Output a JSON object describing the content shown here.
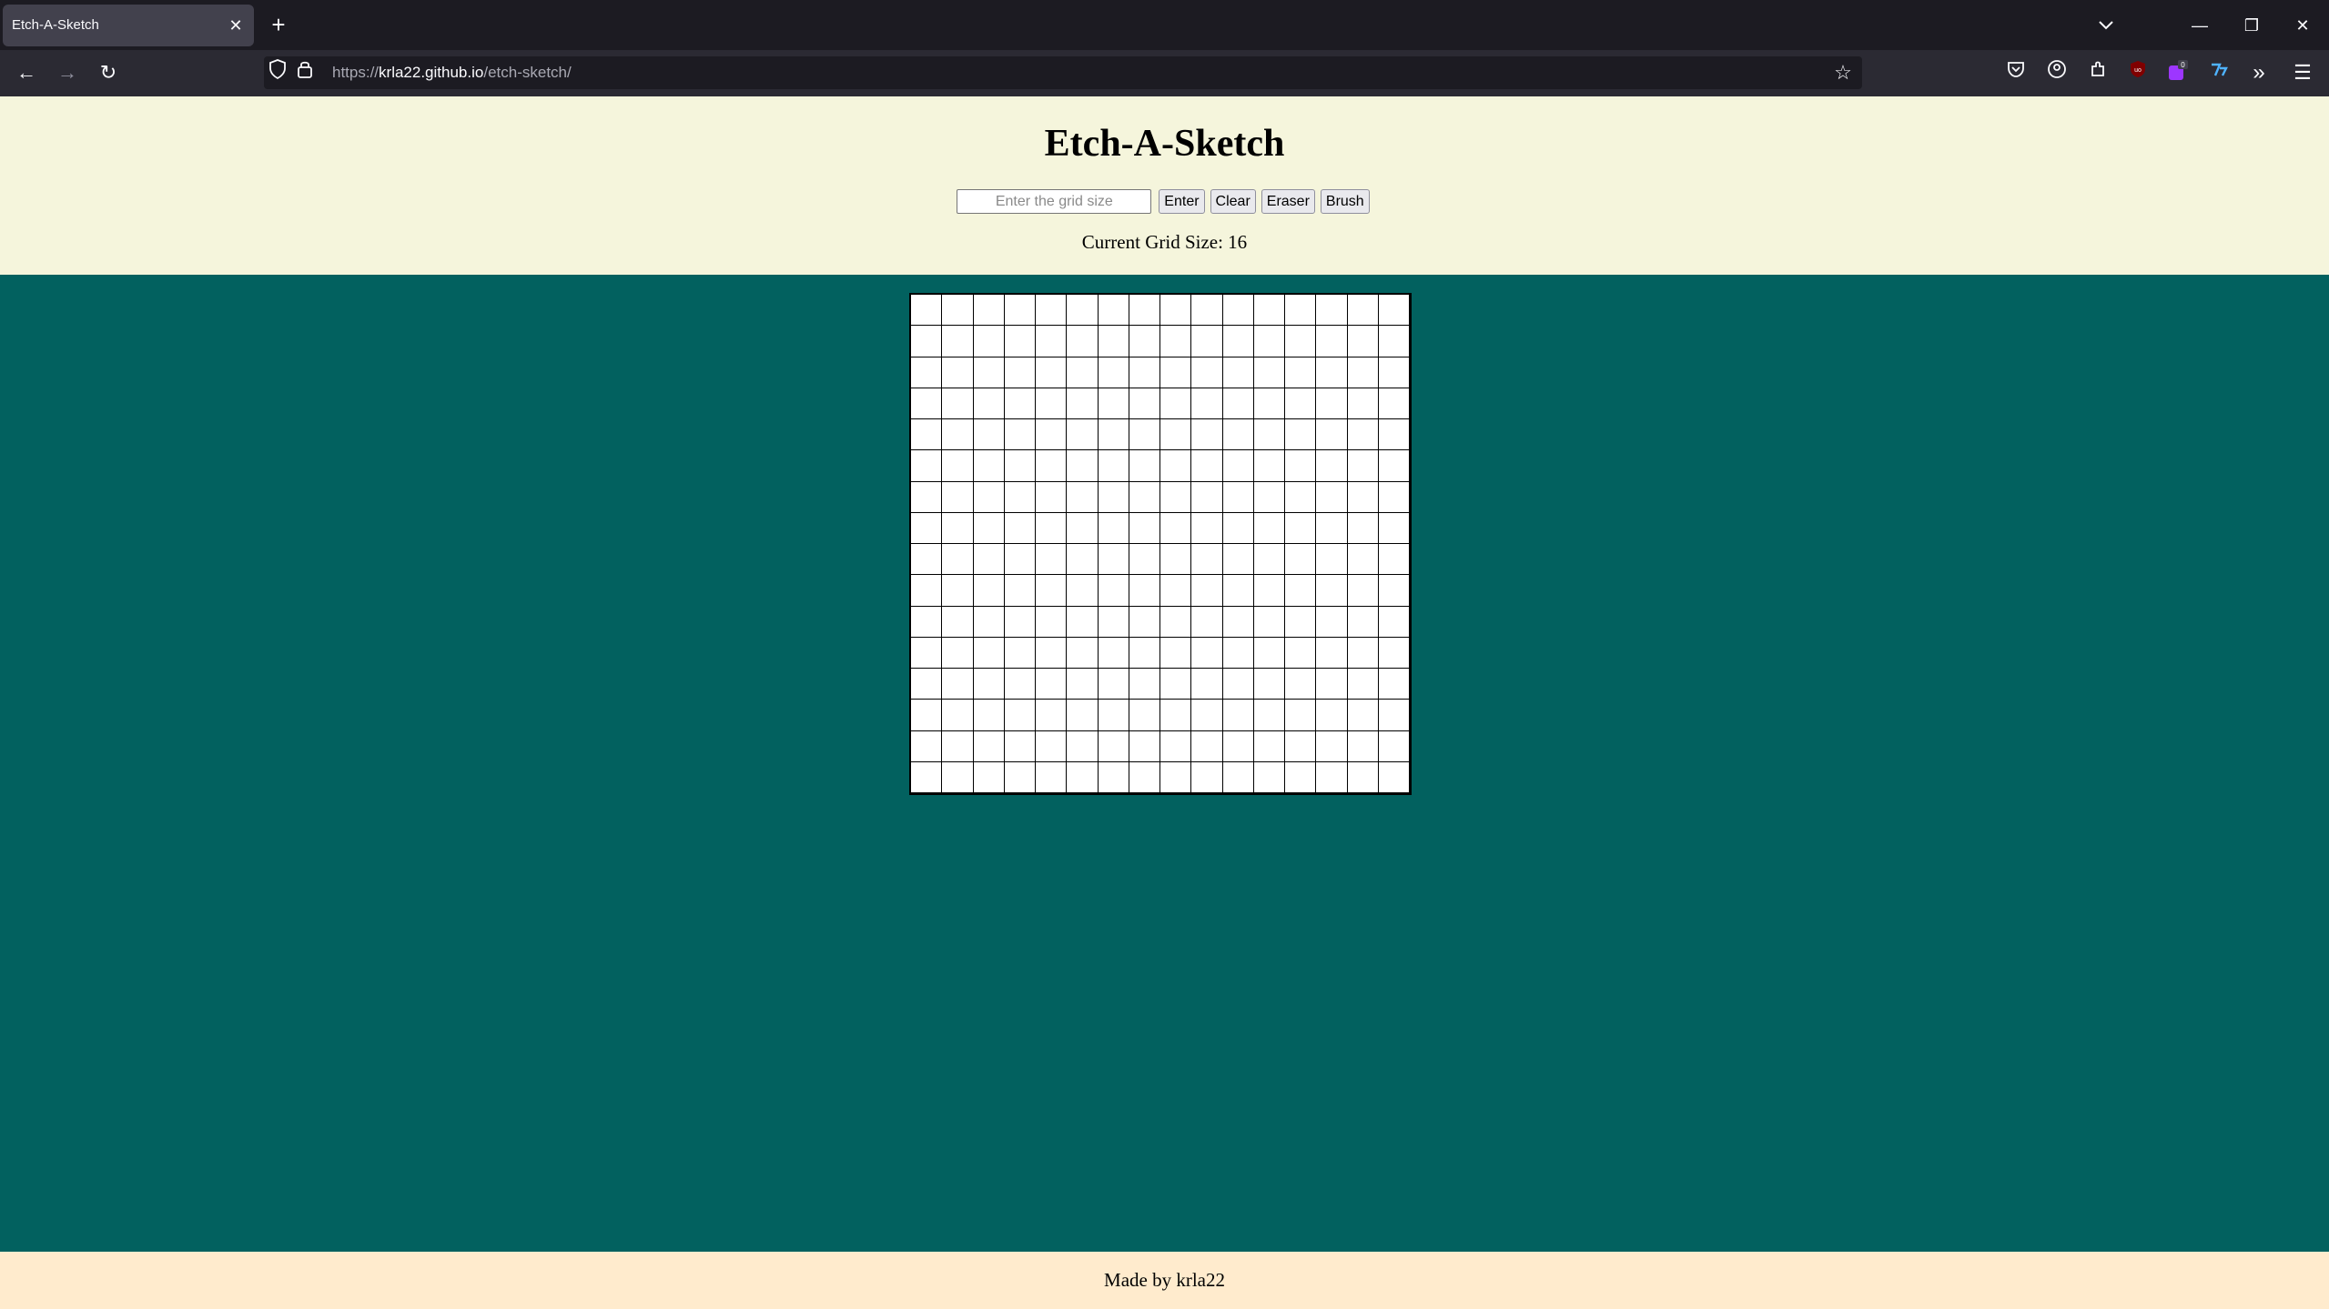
{
  "browser": {
    "tab_title": "Etch-A-Sketch",
    "tab_close": "✕",
    "new_tab": "+",
    "url_prefix": "https://",
    "url_host": "krla22.github.io",
    "url_path": "/etch-sketch/",
    "icons": [
      "back-arrow-icon",
      "forward-arrow-icon",
      "reload-icon",
      "shield-icon",
      "lock-icon",
      "star-icon",
      "pocket-icon",
      "account-icon",
      "extensions-icon",
      "ublock-icon",
      "extension-badge-icon",
      "extension-icon",
      "overflow-icon",
      "hamburger-menu-icon"
    ],
    "extension_badge": "0",
    "ublock_label": "uo"
  },
  "header": {
    "title": "Etch-A-Sketch",
    "input_placeholder": "Enter the grid size",
    "enter_label": "Enter",
    "clear_label": "Clear",
    "eraser_label": "Eraser",
    "brush_label": "Brush",
    "status": "Current Grid Size: 16"
  },
  "grid": {
    "size": 16
  },
  "footer": {
    "text": "Made by krla22"
  },
  "colors": {
    "page_bg": "#02615f",
    "header_bg": "#f5f5dc",
    "footer_bg": "#ffebcd",
    "grid_cell": "#ffffff",
    "grid_line": "#000000"
  }
}
